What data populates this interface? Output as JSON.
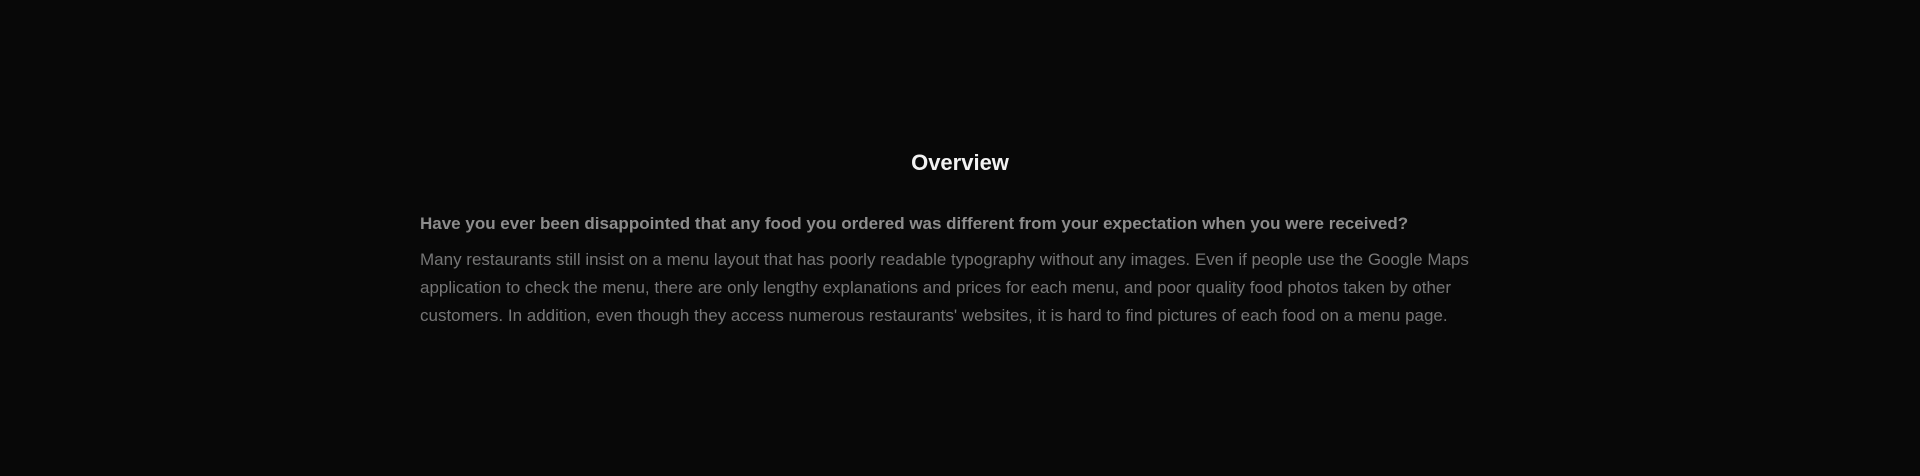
{
  "overview": {
    "title": "Overview",
    "question": "Have you ever been disappointed that any food you ordered was different from your expectation when you were received?",
    "body_lines": [
      "Many restaurants still insist on a menu layout that has poorly readable typography without any images. Even if people use the Google Maps",
      "application to check the menu, there are only lengthy explanations and prices for each menu, and poor quality food photos taken by other",
      "customers. In addition, even though they access numerous restaurants' websites, it is hard to find pictures of each food on a menu page."
    ]
  }
}
